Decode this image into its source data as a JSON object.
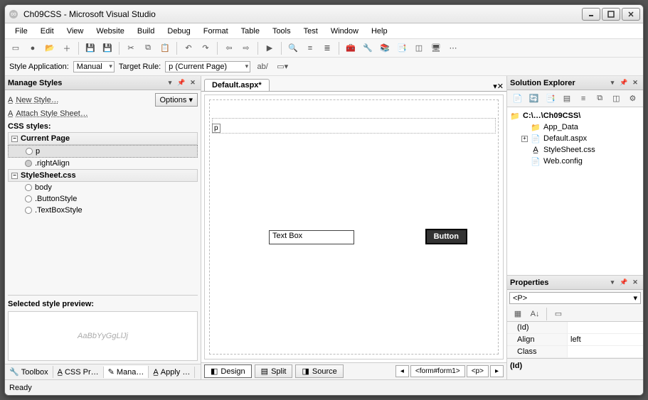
{
  "window": {
    "title": "Ch09CSS - Microsoft Visual Studio"
  },
  "menu": [
    "File",
    "Edit",
    "View",
    "Website",
    "Build",
    "Debug",
    "Format",
    "Table",
    "Tools",
    "Test",
    "Window",
    "Help"
  ],
  "style_app_bar": {
    "label": "Style Application:",
    "mode": "Manual",
    "target_label": "Target Rule:",
    "target_value": "p (Current Page)"
  },
  "manage_styles": {
    "title": "Manage Styles",
    "new_style": "New Style…",
    "attach": "Attach Style Sheet…",
    "options": "Options ▾",
    "section_title": "CSS styles:",
    "groups": [
      {
        "name": "Current Page",
        "items": [
          "p",
          ".rightAlign"
        ]
      },
      {
        "name": "StyleSheet.css",
        "items": [
          "body",
          ".ButtonStyle",
          ".TextBoxStyle"
        ]
      }
    ],
    "preview_title": "Selected style preview:",
    "preview_sample": "AaBbYyGgLlJj"
  },
  "left_bottom_tabs": [
    "Toolbox",
    "CSS Pr…",
    "Mana…",
    "Apply …"
  ],
  "doc": {
    "tab": "Default.aspx*",
    "p_tag": "p",
    "textbox": "Text Box",
    "button": "Button",
    "views": [
      "Design",
      "Split",
      "Source"
    ],
    "crumbs": [
      "<form#form1>",
      "<p>"
    ]
  },
  "solution_explorer": {
    "title": "Solution Explorer",
    "root": "C:\\…\\Ch09CSS\\",
    "items": [
      "App_Data",
      "Default.aspx",
      "StyleSheet.css",
      "Web.config"
    ]
  },
  "properties": {
    "title": "Properties",
    "object": "<P>",
    "rows": [
      {
        "name": "(Id)",
        "value": ""
      },
      {
        "name": "Align",
        "value": "left"
      },
      {
        "name": "Class",
        "value": ""
      }
    ],
    "desc_label": "(Id)"
  },
  "status": "Ready"
}
